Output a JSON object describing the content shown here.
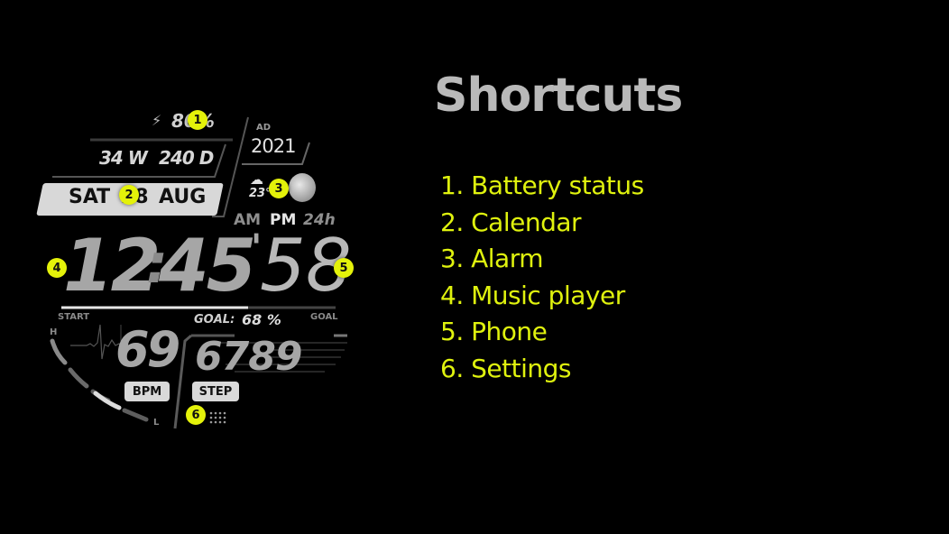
{
  "watch_face": {
    "battery": {
      "icon": "bolt-icon",
      "value": "80%"
    },
    "week_day_of_year": {
      "week": "34 W",
      "day": "240 D"
    },
    "date": {
      "weekday": "SAT",
      "day": "28",
      "month": "AUG"
    },
    "era": {
      "label": "AD",
      "year": "2021"
    },
    "weather": {
      "icon": "cloud-icon",
      "temperature": "23°"
    },
    "moon_phase": {
      "icon": "moon-icon"
    },
    "time_format": {
      "am": "AM",
      "pm": "PM",
      "h24": "24h"
    },
    "time": {
      "hours": "12",
      "separator": ":",
      "minutes": "45",
      "seconds_mark": "'",
      "seconds": "58"
    },
    "goal": {
      "start_label": "START",
      "end_label": "GOAL",
      "label": "GOAL:",
      "value": "68 %",
      "progress_percent": 68
    },
    "heart_rate": {
      "high_label": "H",
      "low_label": "L",
      "value": "69",
      "unit": "BPM"
    },
    "steps": {
      "value": "6789",
      "unit": "STEP"
    },
    "shortcut_badges": [
      "1",
      "2",
      "3",
      "4",
      "5",
      "6"
    ]
  },
  "shortcuts": {
    "title": "Shortcuts",
    "items": [
      "1. Battery status",
      "2. Calendar",
      "3. Alarm",
      "4. Music player",
      "5. Phone",
      "6. Settings"
    ]
  },
  "colors": {
    "accent": "#e4f20a",
    "list_text": "#dff20e",
    "title": "#b9b9b9",
    "background": "#000000"
  }
}
